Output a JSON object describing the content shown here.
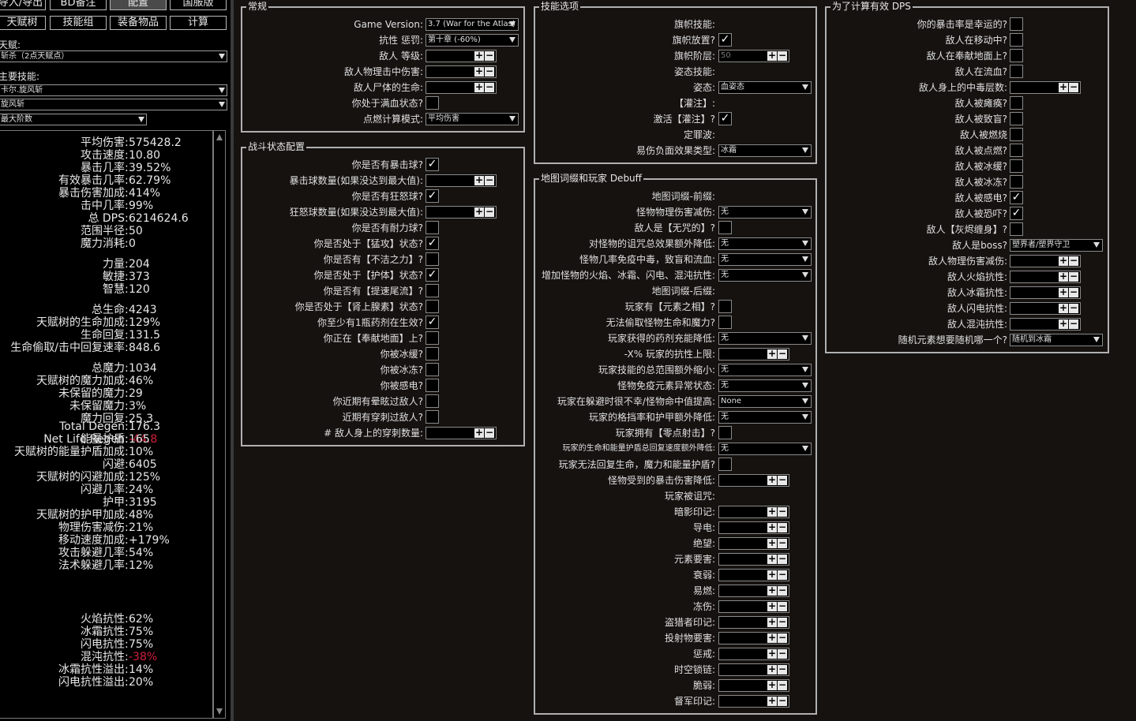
{
  "top_buttons": [
    {
      "label": "导入/导出"
    },
    {
      "label": "BD备注"
    },
    {
      "label": "配置"
    },
    {
      "label": "国服版"
    },
    {
      "label": "天赋树"
    },
    {
      "label": "技能组"
    },
    {
      "label": "装备物品"
    },
    {
      "label": "计算"
    }
  ],
  "left": {
    "talent_label": "天赋:",
    "talent_value": "斩杀（2点天赋点）",
    "main_skill_label": "主要技能:",
    "skill_1": "卡尔.旋风斩",
    "skill_2": "旋风斩",
    "stage": "最大阶数"
  },
  "stats": [
    {
      "k": "平均伤害",
      "v": "575428.2"
    },
    {
      "k": "攻击速度",
      "v": "10.80"
    },
    {
      "k": "暴击几率",
      "v": "39.52%"
    },
    {
      "k": "有效暴击几率",
      "v": "62.79%"
    },
    {
      "k": "暴击伤害加成",
      "v": "414%"
    },
    {
      "k": "击中几率",
      "v": "99%"
    },
    {
      "k": "总 DPS",
      "v": "6214624.6"
    },
    {
      "k": "范围半径",
      "v": "50"
    },
    {
      "k": "魔力消耗",
      "v": "0"
    },
    {
      "k": "力量",
      "v": "204"
    },
    {
      "k": "敏捷",
      "v": "373"
    },
    {
      "k": "智慧",
      "v": "120"
    },
    {
      "k": "总生命",
      "v": "4243"
    },
    {
      "k": "天赋树的生命加成",
      "v": "129%"
    },
    {
      "k": "生命回复",
      "v": "131.5"
    },
    {
      "k": "生命偷取/击中回复速率",
      "v": "848.6"
    },
    {
      "k": "总魔力",
      "v": "1034"
    },
    {
      "k": "天赋树的魔力加成",
      "v": "46%"
    },
    {
      "k": "未保留的魔力",
      "v": "29"
    },
    {
      "k": "未保留魔力",
      "v": "3%"
    },
    {
      "k": "魔力回复",
      "v": "25.3"
    },
    {
      "k": "Total Degen",
      "v": "176.3"
    },
    {
      "k": "Net Life Regen",
      "v": "-44.8"
    },
    {
      "k": "能量护盾",
      "v": "165"
    },
    {
      "k": "天赋树的能量护盾加成",
      "v": "10%"
    },
    {
      "k": "闪避",
      "v": "6405"
    },
    {
      "k": "天赋树的闪避加成",
      "v": "125%"
    },
    {
      "k": "闪避几率",
      "v": "24%"
    },
    {
      "k": "护甲",
      "v": "3195"
    },
    {
      "k": "天赋树的护甲加成",
      "v": "48%"
    },
    {
      "k": "物理伤害减伤",
      "v": "21%"
    },
    {
      "k": "移动速度加成",
      "v": "+179%"
    },
    {
      "k": "攻击躲避几率",
      "v": "54%"
    },
    {
      "k": "法术躲避几率",
      "v": "12%"
    },
    {
      "k": "火焰抗性",
      "v": "62%"
    },
    {
      "k": "冰霜抗性",
      "v": "75%"
    },
    {
      "k": "闪电抗性",
      "v": "75%"
    },
    {
      "k": "混沌抗性",
      "v": "-38%"
    },
    {
      "k": "冰霜抗性溢出",
      "v": "14%"
    },
    {
      "k": "闪电抗性溢出",
      "v": "20%"
    }
  ],
  "stat_colors": {
    "normal": "#e8e8e8",
    "negative": "#d0203a"
  },
  "general": {
    "title": "常规",
    "rows": [
      {
        "label": "Game Version:",
        "drop": "3.7 (War for the Atlas)"
      },
      {
        "label": "抗性 惩罚:",
        "drop": "第十章 (-60%)"
      },
      {
        "label": "敌人 等级:",
        "num": ""
      },
      {
        "label": "敌人物理击中伤害:",
        "num": ""
      },
      {
        "label": "敌人尸体的生命:",
        "num": ""
      },
      {
        "label": "你处于满血状态?",
        "check": false
      },
      {
        "label": "点燃计算模式:",
        "drop": "平均伤害"
      }
    ]
  },
  "combat": {
    "title": "战斗状态配置",
    "rows": [
      {
        "label": "你是否有暴击球?",
        "check": true
      },
      {
        "label": "暴击球数量(如果没达到最大值):",
        "num": ""
      },
      {
        "label": "你是否有狂怒球?",
        "check": true
      },
      {
        "label": "狂怒球数量(如果没达到最大值):",
        "num": ""
      },
      {
        "label": "你是否有耐力球?",
        "check": false
      },
      {
        "label": "你是否处于【猛攻】状态?",
        "check": true
      },
      {
        "label": "你是否有【不洁之力】?",
        "check": false
      },
      {
        "label": "你是否处于【护体】状态?",
        "check": true
      },
      {
        "label": "你是否有【提速尾流】?",
        "check": false
      },
      {
        "label": "你是否处于【肾上腺素】状态?",
        "check": false
      },
      {
        "label": "你至少有1瓶药剂在生效?",
        "check": true
      },
      {
        "label": "你正在【奉献地面】上?",
        "check": false
      },
      {
        "label": "你被冰缓?",
        "check": false
      },
      {
        "label": "你被冰冻?",
        "check": false
      },
      {
        "label": "你被感电?",
        "check": false
      },
      {
        "label": "你近期有晕眩过敌人?",
        "check": false
      },
      {
        "label": "近期有穿刺过敌人?",
        "check": false
      },
      {
        "label": "# 敌人身上的穿刺数量:",
        "num": ""
      }
    ]
  },
  "skill_opts": {
    "title": "技能选项",
    "rows": [
      {
        "label": "旗帜技能:"
      },
      {
        "label": "旗帜放置?",
        "check": true
      },
      {
        "label": "旗帜阶层:",
        "num": "50"
      },
      {
        "label": "姿态技能:"
      },
      {
        "label": "姿态:",
        "drop": "血姿态"
      },
      {
        "label": "【灌注】:"
      },
      {
        "label": "激活【灌注】?",
        "check": true
      },
      {
        "label": "定罪波:"
      },
      {
        "label": "易伤负面效果类型:",
        "drop": "冰霜"
      }
    ]
  },
  "map": {
    "title": "地图词缀和玩家 Debuff",
    "rows": [
      {
        "label": "地图词缀-前缀:"
      },
      {
        "label": "怪物物理伤害减伤:",
        "drop": "无"
      },
      {
        "label": "敌人是【无咒的】?",
        "check": false
      },
      {
        "label": "对怪物的诅咒总效果额外降低:",
        "drop": "无"
      },
      {
        "label": "怪物几率免疫中毒，致盲和流血:",
        "drop": "无"
      },
      {
        "label": "增加怪物的火焰、冰霜、闪电、混沌抗性:",
        "drop": "无"
      },
      {
        "label": "地图词缀-后缀:"
      },
      {
        "label": "玩家有【元素之相】?",
        "check": false
      },
      {
        "label": "无法偷取怪物生命和魔力?",
        "check": false
      },
      {
        "label": "玩家获得的药剂充能降低:",
        "drop": "无"
      },
      {
        "label": "-X% 玩家的抗性上限:",
        "num": ""
      },
      {
        "label": "玩家技能的总范围额外缩小:",
        "drop": "无"
      },
      {
        "label": "怪物免疫元素异常状态:",
        "drop": "无"
      },
      {
        "label": "玩家在躲避时很不幸/怪物命中值提高:",
        "drop": "None"
      },
      {
        "label": "玩家的格挡率和护甲额外降低:",
        "drop": "无"
      },
      {
        "label": "玩家拥有【零点射击】?",
        "check": false
      },
      {
        "label": "玩家的生命和能量护盾总回复速度额外降低:",
        "drop": "无",
        "small": true
      },
      {
        "label": "玩家无法回复生命，魔力和能量护盾?",
        "check": false
      },
      {
        "label": "怪物受到的暴击伤害降低:",
        "num": ""
      },
      {
        "label": "玩家被诅咒:"
      },
      {
        "label": "暗影印记:",
        "num": ""
      },
      {
        "label": "导电:",
        "num": ""
      },
      {
        "label": "绝望:",
        "num": ""
      },
      {
        "label": "元素要害:",
        "num": ""
      },
      {
        "label": "衰弱:",
        "num": ""
      },
      {
        "label": "易燃:",
        "num": ""
      },
      {
        "label": "冻伤:",
        "num": ""
      },
      {
        "label": "盗猎者印记:",
        "num": ""
      },
      {
        "label": "投射物要害:",
        "num": ""
      },
      {
        "label": "惩戒:",
        "num": ""
      },
      {
        "label": "时空锁链:",
        "num": ""
      },
      {
        "label": "脆弱:",
        "num": ""
      },
      {
        "label": "督军印记:",
        "num": ""
      }
    ]
  },
  "effdps": {
    "title": "为了计算有效 DPS",
    "rows": [
      {
        "label": "你的暴击率是幸运的?",
        "check": false
      },
      {
        "label": "敌人在移动中?",
        "check": false
      },
      {
        "label": "敌人在奉献地面上?",
        "check": false
      },
      {
        "label": "敌人在流血?",
        "check": false
      },
      {
        "label": "敌人身上的中毒层数:",
        "num": ""
      },
      {
        "label": "敌人被瘫痪?",
        "check": false
      },
      {
        "label": "敌人被致盲?",
        "check": false
      },
      {
        "label": "敌人被燃烧",
        "check": false
      },
      {
        "label": "敌人被点燃?",
        "check": false
      },
      {
        "label": "敌人被冰缓?",
        "check": false
      },
      {
        "label": "敌人被冰冻?",
        "check": false
      },
      {
        "label": "敌人被感电?",
        "check": true
      },
      {
        "label": "敌人被恐吓?",
        "check": true
      },
      {
        "label": "敌人【灰烬缠身】?",
        "check": false
      },
      {
        "label": "敌人是boss?",
        "drop": "塑界者/塑界守卫"
      },
      {
        "label": "敌人物理伤害减伤:",
        "num": ""
      },
      {
        "label": "敌人火焰抗性:",
        "num": ""
      },
      {
        "label": "敌人冰霜抗性:",
        "num": ""
      },
      {
        "label": "敌人闪电抗性:",
        "num": ""
      },
      {
        "label": "敌人混沌抗性:",
        "num": ""
      },
      {
        "label": "随机元素想要随机哪一个?",
        "drop": "随机到冰霜"
      }
    ]
  },
  "icons": {
    "check": "✓",
    "plus": "+",
    "minus": "−",
    "dropdown": "triangle-down"
  }
}
